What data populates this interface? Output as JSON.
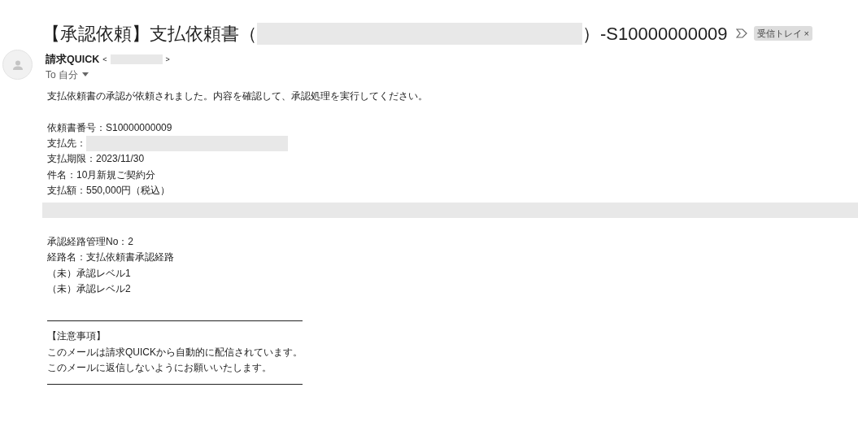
{
  "subject": {
    "before": "【承認依頼】支払依頼書（",
    "after": "）-S10000000009"
  },
  "label_chip": {
    "label": "受信トレイ",
    "close": "×"
  },
  "sender": {
    "name": "請求QUICK",
    "open": "<",
    "close": ">"
  },
  "recipient": {
    "label": "To 自分"
  },
  "body": [
    {
      "kind": "text",
      "text": "支払依頼書の承認が依頼されました。内容を確認して、承認処理を実行してください。"
    },
    {
      "kind": "gap"
    },
    {
      "kind": "text",
      "text": "依頼書番号：S10000000009"
    },
    {
      "kind": "redacted",
      "text": "支払先："
    },
    {
      "kind": "text",
      "text": "支払期限：2023/11/30"
    },
    {
      "kind": "text",
      "text": "件名：10月新規ご契約分"
    },
    {
      "kind": "text",
      "text": "支払額：550,000円（税込）"
    },
    {
      "kind": "bar"
    },
    {
      "kind": "gap"
    },
    {
      "kind": "text",
      "text": "承認経路管理No：2"
    },
    {
      "kind": "text",
      "text": "経路名：支払依頼書承認経路"
    },
    {
      "kind": "text",
      "text": "（未）承認レベル1"
    },
    {
      "kind": "text",
      "text": "（未）承認レベル2"
    },
    {
      "kind": "gap"
    },
    {
      "kind": "rule"
    },
    {
      "kind": "text",
      "text": "【注意事項】"
    },
    {
      "kind": "text",
      "text": "このメールは請求QUICKから自動的に配信されています。"
    },
    {
      "kind": "text",
      "text": "このメールに返信しないようにお願いいたします。"
    },
    {
      "kind": "rule"
    }
  ]
}
